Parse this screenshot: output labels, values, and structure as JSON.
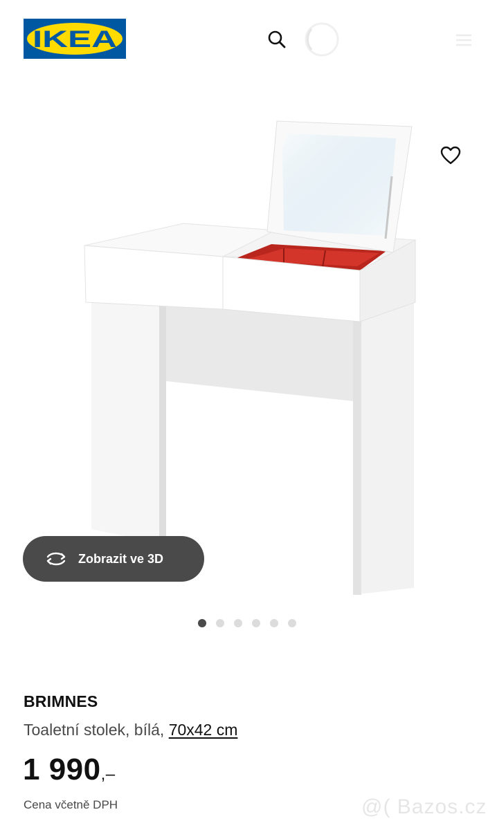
{
  "header": {
    "logo_text": "IKEA",
    "brand_colors": {
      "blue": "#0058a3",
      "yellow": "#ffdb00"
    },
    "icons": [
      "search-icon",
      "profile-icon",
      "menu-icon"
    ]
  },
  "gallery": {
    "favorite_icon": "heart-icon",
    "view3d_label": "Zobrazit ve 3D",
    "view3d_icon": "rotate-icon",
    "dots_total": 6,
    "active_index": 0
  },
  "product": {
    "name": "BRIMNES",
    "description": "Toaletní stolek, bílá, ",
    "dimensions": "70x42 cm",
    "price_main": "1 990",
    "price_suffix": ",–",
    "vat_note": "Cena včetně DPH"
  },
  "watermark": "@( Bazos.cz"
}
